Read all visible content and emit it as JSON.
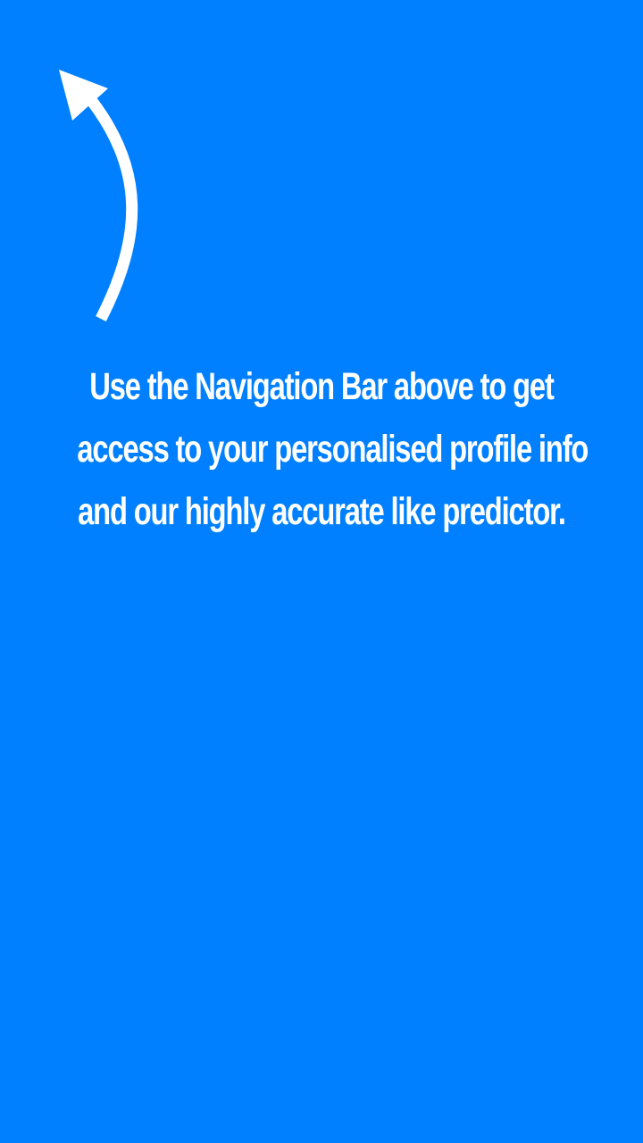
{
  "theme": {
    "background": "#0080ff",
    "text_color": "#ffffff"
  },
  "arrow": {
    "icon": "curved-arrow-up-icon",
    "color": "#ffffff"
  },
  "hint": {
    "lines": [
      "Use the Navigation Bar above to get",
      "access to your personalised profile info",
      "and our highly accurate like predictor."
    ]
  }
}
